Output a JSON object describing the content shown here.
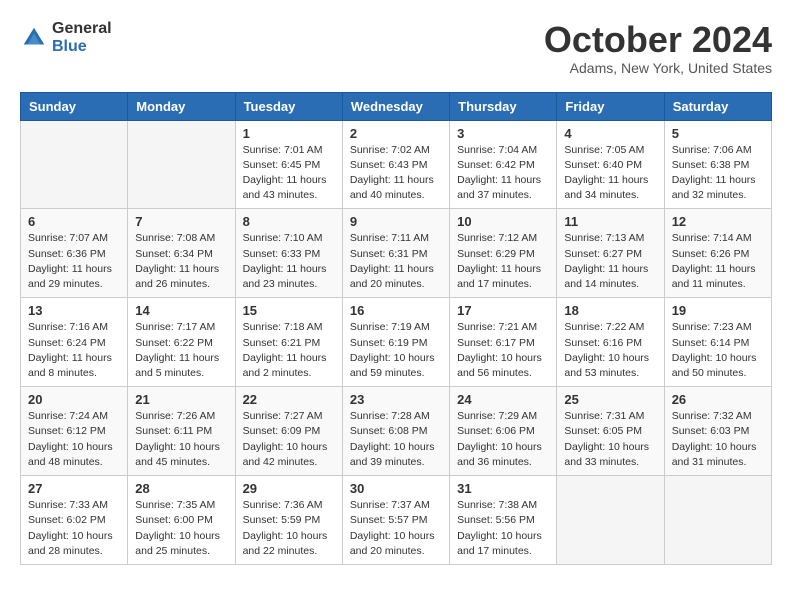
{
  "logo": {
    "general": "General",
    "blue": "Blue"
  },
  "title": "October 2024",
  "location": "Adams, New York, United States",
  "weekdays": [
    "Sunday",
    "Monday",
    "Tuesday",
    "Wednesday",
    "Thursday",
    "Friday",
    "Saturday"
  ],
  "weeks": [
    [
      {
        "day": "",
        "sunrise": "",
        "sunset": "",
        "daylight": ""
      },
      {
        "day": "",
        "sunrise": "",
        "sunset": "",
        "daylight": ""
      },
      {
        "day": "1",
        "sunrise": "Sunrise: 7:01 AM",
        "sunset": "Sunset: 6:45 PM",
        "daylight": "Daylight: 11 hours and 43 minutes."
      },
      {
        "day": "2",
        "sunrise": "Sunrise: 7:02 AM",
        "sunset": "Sunset: 6:43 PM",
        "daylight": "Daylight: 11 hours and 40 minutes."
      },
      {
        "day": "3",
        "sunrise": "Sunrise: 7:04 AM",
        "sunset": "Sunset: 6:42 PM",
        "daylight": "Daylight: 11 hours and 37 minutes."
      },
      {
        "day": "4",
        "sunrise": "Sunrise: 7:05 AM",
        "sunset": "Sunset: 6:40 PM",
        "daylight": "Daylight: 11 hours and 34 minutes."
      },
      {
        "day": "5",
        "sunrise": "Sunrise: 7:06 AM",
        "sunset": "Sunset: 6:38 PM",
        "daylight": "Daylight: 11 hours and 32 minutes."
      }
    ],
    [
      {
        "day": "6",
        "sunrise": "Sunrise: 7:07 AM",
        "sunset": "Sunset: 6:36 PM",
        "daylight": "Daylight: 11 hours and 29 minutes."
      },
      {
        "day": "7",
        "sunrise": "Sunrise: 7:08 AM",
        "sunset": "Sunset: 6:34 PM",
        "daylight": "Daylight: 11 hours and 26 minutes."
      },
      {
        "day": "8",
        "sunrise": "Sunrise: 7:10 AM",
        "sunset": "Sunset: 6:33 PM",
        "daylight": "Daylight: 11 hours and 23 minutes."
      },
      {
        "day": "9",
        "sunrise": "Sunrise: 7:11 AM",
        "sunset": "Sunset: 6:31 PM",
        "daylight": "Daylight: 11 hours and 20 minutes."
      },
      {
        "day": "10",
        "sunrise": "Sunrise: 7:12 AM",
        "sunset": "Sunset: 6:29 PM",
        "daylight": "Daylight: 11 hours and 17 minutes."
      },
      {
        "day": "11",
        "sunrise": "Sunrise: 7:13 AM",
        "sunset": "Sunset: 6:27 PM",
        "daylight": "Daylight: 11 hours and 14 minutes."
      },
      {
        "day": "12",
        "sunrise": "Sunrise: 7:14 AM",
        "sunset": "Sunset: 6:26 PM",
        "daylight": "Daylight: 11 hours and 11 minutes."
      }
    ],
    [
      {
        "day": "13",
        "sunrise": "Sunrise: 7:16 AM",
        "sunset": "Sunset: 6:24 PM",
        "daylight": "Daylight: 11 hours and 8 minutes."
      },
      {
        "day": "14",
        "sunrise": "Sunrise: 7:17 AM",
        "sunset": "Sunset: 6:22 PM",
        "daylight": "Daylight: 11 hours and 5 minutes."
      },
      {
        "day": "15",
        "sunrise": "Sunrise: 7:18 AM",
        "sunset": "Sunset: 6:21 PM",
        "daylight": "Daylight: 11 hours and 2 minutes."
      },
      {
        "day": "16",
        "sunrise": "Sunrise: 7:19 AM",
        "sunset": "Sunset: 6:19 PM",
        "daylight": "Daylight: 10 hours and 59 minutes."
      },
      {
        "day": "17",
        "sunrise": "Sunrise: 7:21 AM",
        "sunset": "Sunset: 6:17 PM",
        "daylight": "Daylight: 10 hours and 56 minutes."
      },
      {
        "day": "18",
        "sunrise": "Sunrise: 7:22 AM",
        "sunset": "Sunset: 6:16 PM",
        "daylight": "Daylight: 10 hours and 53 minutes."
      },
      {
        "day": "19",
        "sunrise": "Sunrise: 7:23 AM",
        "sunset": "Sunset: 6:14 PM",
        "daylight": "Daylight: 10 hours and 50 minutes."
      }
    ],
    [
      {
        "day": "20",
        "sunrise": "Sunrise: 7:24 AM",
        "sunset": "Sunset: 6:12 PM",
        "daylight": "Daylight: 10 hours and 48 minutes."
      },
      {
        "day": "21",
        "sunrise": "Sunrise: 7:26 AM",
        "sunset": "Sunset: 6:11 PM",
        "daylight": "Daylight: 10 hours and 45 minutes."
      },
      {
        "day": "22",
        "sunrise": "Sunrise: 7:27 AM",
        "sunset": "Sunset: 6:09 PM",
        "daylight": "Daylight: 10 hours and 42 minutes."
      },
      {
        "day": "23",
        "sunrise": "Sunrise: 7:28 AM",
        "sunset": "Sunset: 6:08 PM",
        "daylight": "Daylight: 10 hours and 39 minutes."
      },
      {
        "day": "24",
        "sunrise": "Sunrise: 7:29 AM",
        "sunset": "Sunset: 6:06 PM",
        "daylight": "Daylight: 10 hours and 36 minutes."
      },
      {
        "day": "25",
        "sunrise": "Sunrise: 7:31 AM",
        "sunset": "Sunset: 6:05 PM",
        "daylight": "Daylight: 10 hours and 33 minutes."
      },
      {
        "day": "26",
        "sunrise": "Sunrise: 7:32 AM",
        "sunset": "Sunset: 6:03 PM",
        "daylight": "Daylight: 10 hours and 31 minutes."
      }
    ],
    [
      {
        "day": "27",
        "sunrise": "Sunrise: 7:33 AM",
        "sunset": "Sunset: 6:02 PM",
        "daylight": "Daylight: 10 hours and 28 minutes."
      },
      {
        "day": "28",
        "sunrise": "Sunrise: 7:35 AM",
        "sunset": "Sunset: 6:00 PM",
        "daylight": "Daylight: 10 hours and 25 minutes."
      },
      {
        "day": "29",
        "sunrise": "Sunrise: 7:36 AM",
        "sunset": "Sunset: 5:59 PM",
        "daylight": "Daylight: 10 hours and 22 minutes."
      },
      {
        "day": "30",
        "sunrise": "Sunrise: 7:37 AM",
        "sunset": "Sunset: 5:57 PM",
        "daylight": "Daylight: 10 hours and 20 minutes."
      },
      {
        "day": "31",
        "sunrise": "Sunrise: 7:38 AM",
        "sunset": "Sunset: 5:56 PM",
        "daylight": "Daylight: 10 hours and 17 minutes."
      },
      {
        "day": "",
        "sunrise": "",
        "sunset": "",
        "daylight": ""
      },
      {
        "day": "",
        "sunrise": "",
        "sunset": "",
        "daylight": ""
      }
    ]
  ]
}
